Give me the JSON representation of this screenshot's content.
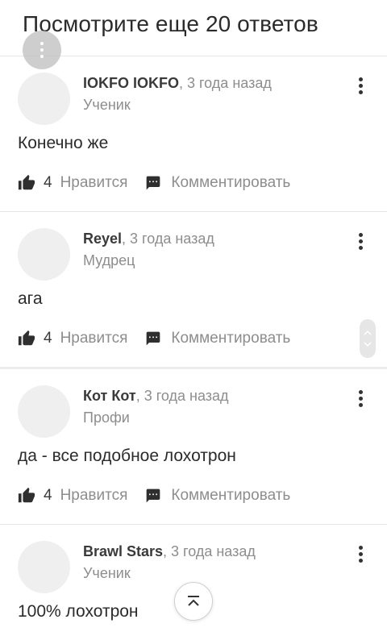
{
  "header": {
    "title": "Посмотрите еще 20 ответов"
  },
  "answers": [
    {
      "name": "IOKFO IOKFO",
      "time": ", 3 года назад",
      "rank": "Ученик",
      "text": "Конечно же",
      "likes": "4",
      "like_label": "Нравится",
      "comment_label": "Комментировать"
    },
    {
      "name": "Reyel",
      "time": ", 3 года назад",
      "rank": "Мудрец",
      "text": "ага",
      "likes": "4",
      "like_label": "Нравится",
      "comment_label": "Комментировать"
    },
    {
      "name": "Кот Кот",
      "time": ", 3 года назад",
      "rank": "Профи",
      "text": "да - все подобное лохотрон",
      "likes": "4",
      "like_label": "Нравится",
      "comment_label": "Комментировать"
    },
    {
      "name": "Brawl Stars",
      "time": ", 3 года назад",
      "rank": "Ученик",
      "text": "100% лохотрон"
    }
  ],
  "icons": {
    "like": "thumbs-up-icon",
    "comment": "comment-icon",
    "more": "more-vertical-icon",
    "scroll_top": "chevron-up-double-icon"
  }
}
